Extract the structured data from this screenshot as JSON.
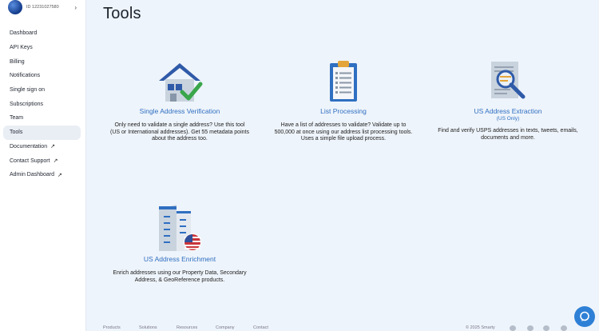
{
  "account": {
    "id": "ID 12231027580"
  },
  "sidebar": {
    "items": [
      {
        "label": "Dashboard",
        "external": false,
        "active": false
      },
      {
        "label": "API Keys",
        "external": false,
        "active": false
      },
      {
        "label": "Billing",
        "external": false,
        "active": false
      },
      {
        "label": "Notifications",
        "external": false,
        "active": false
      },
      {
        "label": "Single sign on",
        "external": false,
        "active": false
      },
      {
        "label": "Subscriptions",
        "external": false,
        "active": false
      },
      {
        "label": "Team",
        "external": false,
        "active": false
      },
      {
        "label": "Tools",
        "external": false,
        "active": true
      },
      {
        "label": "Documentation",
        "external": true,
        "active": false
      },
      {
        "label": "Contact Support",
        "external": true,
        "active": false
      },
      {
        "label": "Admin Dashboard",
        "external": true,
        "active": false
      }
    ]
  },
  "main": {
    "title": "Tools",
    "cards": [
      {
        "title": "Single Address Verification",
        "subtitle": "",
        "description": "Only need to validate a single address? Use this tool (US or International addresses). Get 55 metadata points about the address too.",
        "icon": "house-check-icon"
      },
      {
        "title": "List Processing",
        "subtitle": "",
        "description": "Have a list of addresses to validate? Validate up to 500,000 at once using our address list processing tools. Uses a simple file upload process.",
        "icon": "clipboard-icon"
      },
      {
        "title": "US Address Extraction",
        "subtitle": "(US Only)",
        "description": "Find and verify USPS addresses in texts, tweets, emails, documents and more.",
        "icon": "document-magnifier-icon"
      },
      {
        "title": "US Address Enrichment",
        "subtitle": "",
        "description": "Enrich addresses using our Property Data, Secondary Address, & GeoReference products.",
        "icon": "buildings-flag-icon"
      }
    ]
  },
  "footer": {
    "links": [
      "Products",
      "Solutions",
      "Resources",
      "Company",
      "Contact"
    ],
    "copyright": "© 2025 Smarty"
  },
  "colors": {
    "accent": "#2f6fc1",
    "background": "#eef4fb",
    "help_button": "#2e80d6"
  }
}
